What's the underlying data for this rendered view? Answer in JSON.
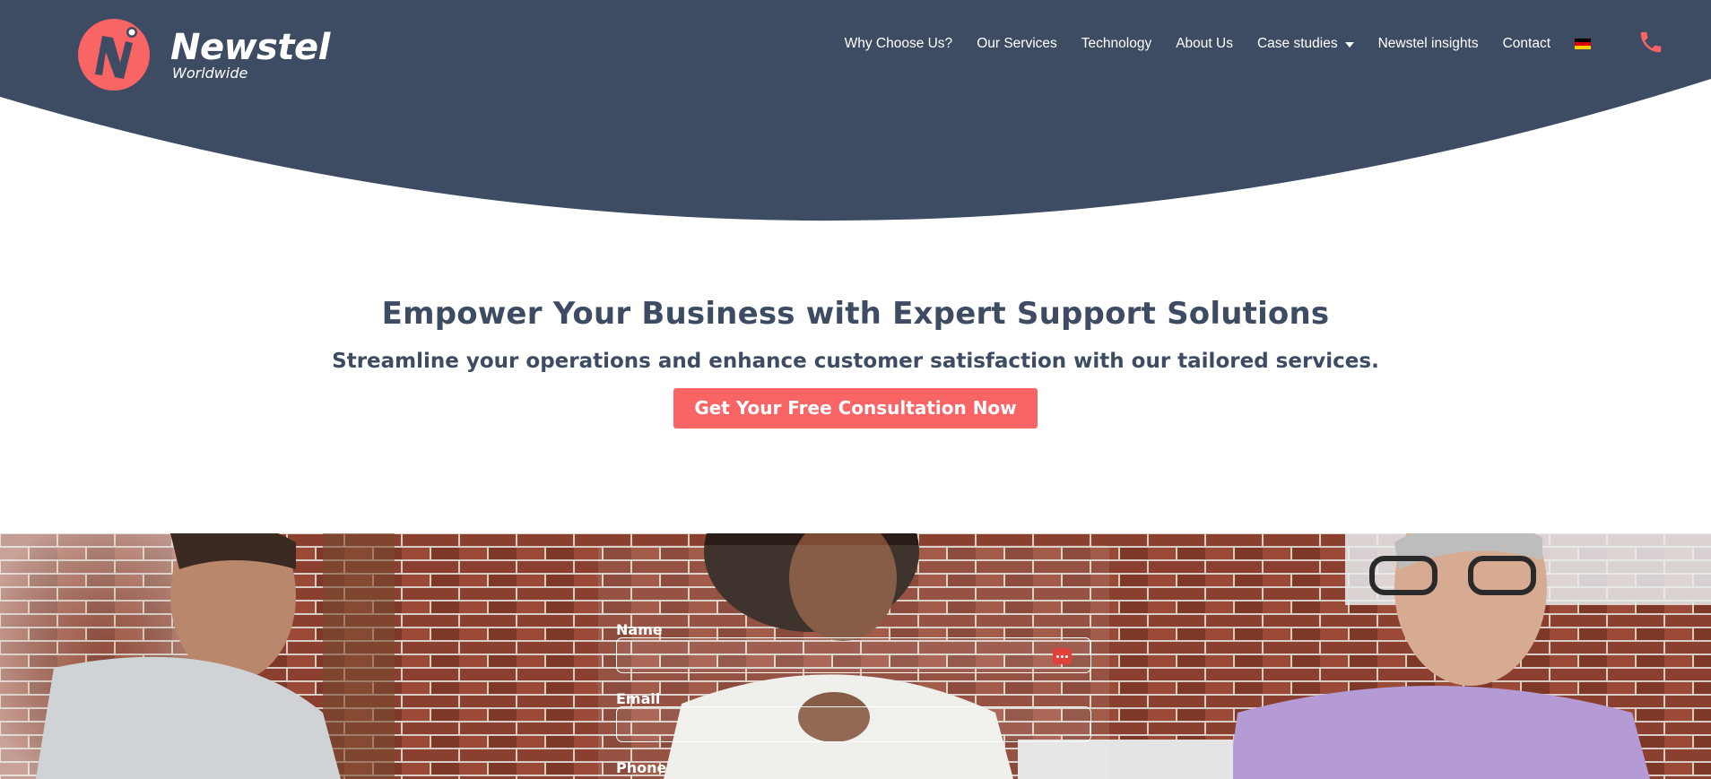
{
  "header": {
    "logo": {
      "name": "Newstel",
      "sub": "Worldwide"
    },
    "nav": [
      {
        "label": "Why Choose Us?"
      },
      {
        "label": "Our Services"
      },
      {
        "label": "Technology"
      },
      {
        "label": "About Us"
      },
      {
        "label": "Case studies",
        "has_dropdown": true
      },
      {
        "label": "Newstel insights"
      },
      {
        "label": "Contact"
      }
    ],
    "language_icon": "germany-flag-icon",
    "phone_icon": "phone-icon",
    "colors": {
      "navy": "#3d4b63",
      "accent": "#f96464"
    }
  },
  "intro": {
    "headline": "Empower Your Business with Expert Support Solutions",
    "subheadline": "Streamline your operations and enhance customer satisfaction with our tailored services.",
    "cta_label": "Get Your Free Consultation Now"
  },
  "form": {
    "name_label": "Name",
    "email_label": "Email",
    "phone_label": "Phone",
    "name_value": "",
    "email_value": ""
  }
}
